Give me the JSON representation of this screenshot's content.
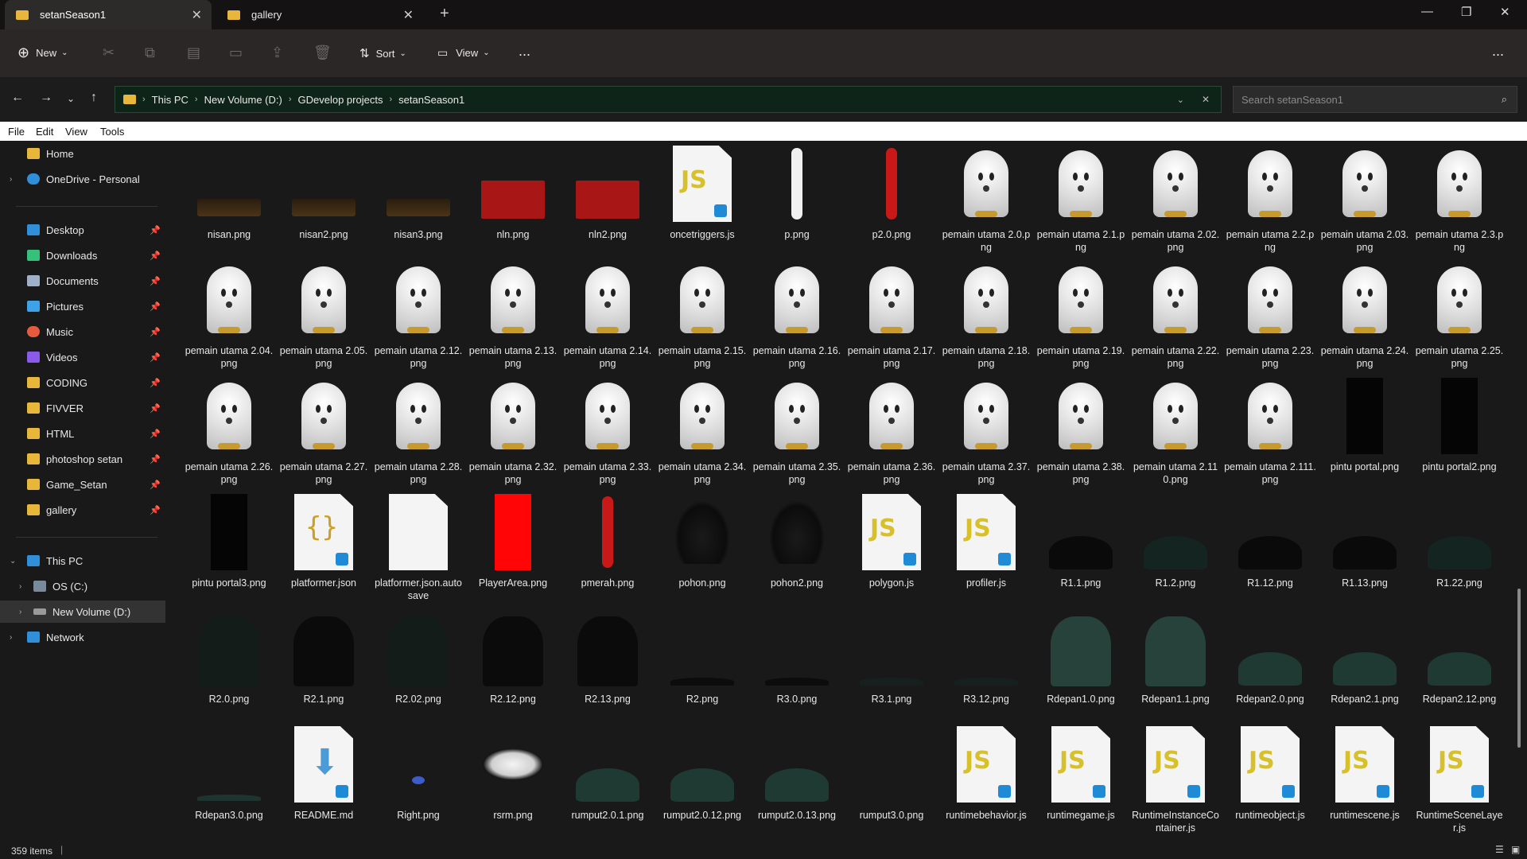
{
  "tabs": [
    {
      "label": "setanSeason1",
      "active": true
    },
    {
      "label": "gallery",
      "active": false
    }
  ],
  "toolbar": {
    "new_label": "New",
    "sort_label": "Sort",
    "view_label": "View",
    "more_label": "..."
  },
  "breadcrumb": [
    "This PC",
    "New Volume (D:)",
    "GDevelop projects",
    "setanSeason1"
  ],
  "search": {
    "placeholder": "Search setanSeason1"
  },
  "menu": [
    "File",
    "Edit",
    "View",
    "Tools"
  ],
  "sidebar": {
    "top": [
      {
        "label": "Home",
        "icon": "home-icon"
      },
      {
        "label": "OneDrive - Personal",
        "icon": "cloud-icon"
      }
    ],
    "quick": [
      {
        "label": "Desktop",
        "icon": "desktop-icon",
        "color": "#2f8fd8"
      },
      {
        "label": "Downloads",
        "icon": "download-icon",
        "color": "#37c07a"
      },
      {
        "label": "Documents",
        "icon": "document-icon",
        "color": "#9fb0c8"
      },
      {
        "label": "Pictures",
        "icon": "picture-icon",
        "color": "#3da2e8"
      },
      {
        "label": "Music",
        "icon": "music-icon",
        "color": "#e85a3d"
      },
      {
        "label": "Videos",
        "icon": "video-icon",
        "color": "#8a5ae8"
      },
      {
        "label": "CODING",
        "icon": "folder-icon",
        "color": "#e8b63a"
      },
      {
        "label": "FIVVER",
        "icon": "folder-icon",
        "color": "#e8b63a"
      },
      {
        "label": "HTML",
        "icon": "folder-icon",
        "color": "#e8b63a"
      },
      {
        "label": "photoshop setan",
        "icon": "folder-icon",
        "color": "#e8b63a"
      },
      {
        "label": "Game_Setan",
        "icon": "folder-icon",
        "color": "#e8b63a"
      },
      {
        "label": "gallery",
        "icon": "folder-icon",
        "color": "#e8b63a"
      }
    ],
    "pc": [
      {
        "label": "This PC",
        "icon": "pc-icon"
      },
      {
        "label": "OS (C:)",
        "icon": "drive-icon"
      },
      {
        "label": "New Volume (D:)",
        "icon": "drive-icon"
      },
      {
        "label": "Network",
        "icon": "network-icon"
      }
    ]
  },
  "files": [
    {
      "name": "nisan.png",
      "kind": "bar"
    },
    {
      "name": "nisan2.png",
      "kind": "bar"
    },
    {
      "name": "nisan3.png",
      "kind": "bar"
    },
    {
      "name": "nln.png",
      "kind": "redrect"
    },
    {
      "name": "nln2.png",
      "kind": "redrect"
    },
    {
      "name": "oncetriggers.js",
      "kind": "js"
    },
    {
      "name": "p.png",
      "kind": "pole-white"
    },
    {
      "name": "p2.0.png",
      "kind": "pole-red"
    },
    {
      "name": "pemain utama 2.0.png",
      "kind": "ghost"
    },
    {
      "name": "pemain utama 2.1.png",
      "kind": "ghost"
    },
    {
      "name": "pemain utama 2.02.png",
      "kind": "ghost"
    },
    {
      "name": "pemain utama 2.2.png",
      "kind": "ghost"
    },
    {
      "name": "pemain utama 2.03.png",
      "kind": "ghost"
    },
    {
      "name": "pemain utama 2.3.png",
      "kind": "ghost"
    },
    {
      "name": "pemain utama 2.04.png",
      "kind": "ghost"
    },
    {
      "name": "pemain utama 2.05.png",
      "kind": "ghost"
    },
    {
      "name": "pemain utama 2.12.png",
      "kind": "ghost"
    },
    {
      "name": "pemain utama 2.13.png",
      "kind": "ghost"
    },
    {
      "name": "pemain utama 2.14.png",
      "kind": "ghost"
    },
    {
      "name": "pemain utama 2.15.png",
      "kind": "ghost"
    },
    {
      "name": "pemain utama 2.16.png",
      "kind": "ghost"
    },
    {
      "name": "pemain utama 2.17.png",
      "kind": "ghost"
    },
    {
      "name": "pemain utama 2.18.png",
      "kind": "ghost"
    },
    {
      "name": "pemain utama 2.19.png",
      "kind": "ghost"
    },
    {
      "name": "pemain utama 2.22.png",
      "kind": "ghost"
    },
    {
      "name": "pemain utama 2.23.png",
      "kind": "ghost"
    },
    {
      "name": "pemain utama 2.24.png",
      "kind": "ghost"
    },
    {
      "name": "pemain utama 2.25.png",
      "kind": "ghost"
    },
    {
      "name": "pemain utama 2.26.png",
      "kind": "ghost"
    },
    {
      "name": "pemain utama 2.27.png",
      "kind": "ghost"
    },
    {
      "name": "pemain utama 2.28.png",
      "kind": "ghost"
    },
    {
      "name": "pemain utama 2.32.png",
      "kind": "ghost"
    },
    {
      "name": "pemain utama 2.33.png",
      "kind": "ghost"
    },
    {
      "name": "pemain utama 2.34.png",
      "kind": "ghost"
    },
    {
      "name": "pemain utama 2.35.png",
      "kind": "ghost"
    },
    {
      "name": "pemain utama 2.36.png",
      "kind": "ghost"
    },
    {
      "name": "pemain utama 2.37.png",
      "kind": "ghost"
    },
    {
      "name": "pemain utama 2.38.png",
      "kind": "ghost"
    },
    {
      "name": "pemain utama 2.110.png",
      "kind": "ghost"
    },
    {
      "name": "pemain utama 2.111.png",
      "kind": "ghost"
    },
    {
      "name": "pintu portal.png",
      "kind": "black"
    },
    {
      "name": "pintu portal2.png",
      "kind": "black"
    },
    {
      "name": "pintu portal3.png",
      "kind": "black"
    },
    {
      "name": "platformer.json",
      "kind": "json"
    },
    {
      "name": "platformer.json.autosave",
      "kind": "blank"
    },
    {
      "name": "PlayerArea.png",
      "kind": "red"
    },
    {
      "name": "pmerah.png",
      "kind": "pole-red"
    },
    {
      "name": "pohon.png",
      "kind": "tree"
    },
    {
      "name": "pohon2.png",
      "kind": "tree"
    },
    {
      "name": "polygon.js",
      "kind": "js"
    },
    {
      "name": "profiler.js",
      "kind": "js"
    },
    {
      "name": "R1.1.png",
      "kind": "bush-black"
    },
    {
      "name": "R1.2.png",
      "kind": "bush-dark"
    },
    {
      "name": "R1.12.png",
      "kind": "bush-black"
    },
    {
      "name": "R1.13.png",
      "kind": "bush-black"
    },
    {
      "name": "R1.22.png",
      "kind": "bush-dark"
    },
    {
      "name": "R2.0.png",
      "kind": "tall-dark"
    },
    {
      "name": "R2.1.png",
      "kind": "tall-black"
    },
    {
      "name": "R2.02.png",
      "kind": "tall-dark"
    },
    {
      "name": "R2.12.png",
      "kind": "tall-black"
    },
    {
      "name": "R2.13.png",
      "kind": "tall-black"
    },
    {
      "name": "R2.png",
      "kind": "flat-black"
    },
    {
      "name": "R3.0.png",
      "kind": "flat-black"
    },
    {
      "name": "R3.1.png",
      "kind": "flat-dark"
    },
    {
      "name": "R3.12.png",
      "kind": "flat-dark"
    },
    {
      "name": "Rdepan1.0.png",
      "kind": "tall-teal"
    },
    {
      "name": "Rdepan1.1.png",
      "kind": "tall-teal"
    },
    {
      "name": "Rdepan2.0.png",
      "kind": "bush-teal"
    },
    {
      "name": "Rdepan2.1.png",
      "kind": "bush-teal"
    },
    {
      "name": "Rdepan2.12.png",
      "kind": "bush-teal"
    },
    {
      "name": "Rdepan3.0.png",
      "kind": "flat-teal"
    },
    {
      "name": "README.md",
      "kind": "md"
    },
    {
      "name": "Right.png",
      "kind": "dot"
    },
    {
      "name": "rsrm.png",
      "kind": "blob"
    },
    {
      "name": "rumput2.0.1.png",
      "kind": "bush-teal"
    },
    {
      "name": "rumput2.0.12.png",
      "kind": "bush-teal"
    },
    {
      "name": "rumput2.0.13.png",
      "kind": "bush-teal"
    },
    {
      "name": "rumput3.0.png",
      "kind": "empty"
    },
    {
      "name": "runtimebehavior.js",
      "kind": "js"
    },
    {
      "name": "runtimegame.js",
      "kind": "js"
    },
    {
      "name": "RuntimeInstanceContainer.js",
      "kind": "js"
    },
    {
      "name": "runtimeobject.js",
      "kind": "js"
    },
    {
      "name": "runtimescene.js",
      "kind": "js"
    },
    {
      "name": "RuntimeSceneLayer.js",
      "kind": "js"
    }
  ],
  "status": {
    "count": "359 items"
  }
}
